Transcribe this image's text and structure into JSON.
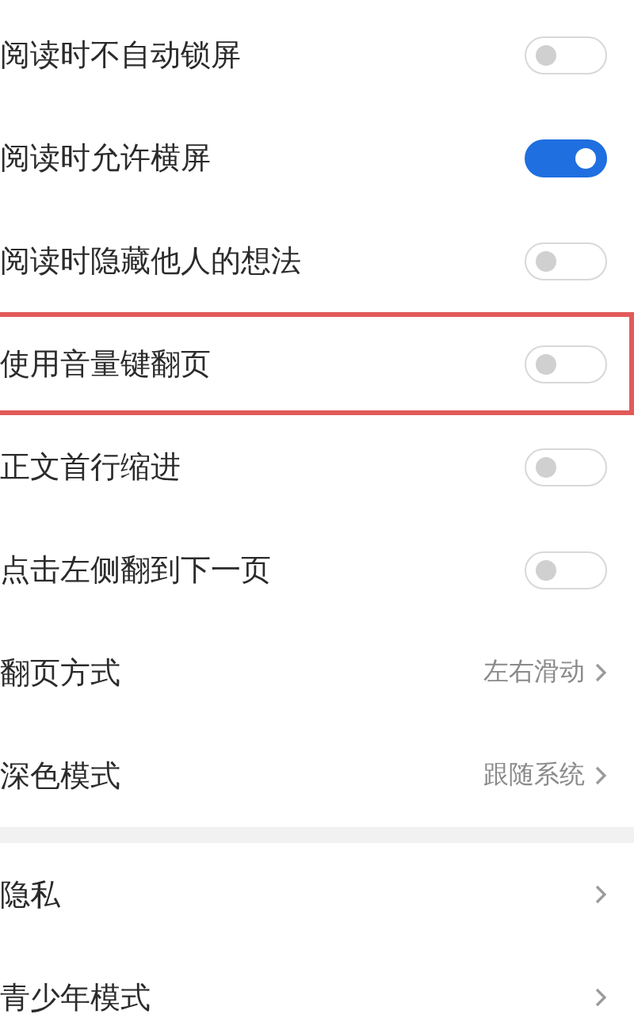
{
  "sections": [
    {
      "items": [
        {
          "kind": "toggle",
          "label": "阅读时不自动锁屏",
          "on": false,
          "highlighted": false
        },
        {
          "kind": "toggle",
          "label": "阅读时允许横屏",
          "on": true,
          "highlighted": false
        },
        {
          "kind": "toggle",
          "label": "阅读时隐藏他人的想法",
          "on": false,
          "highlighted": false
        },
        {
          "kind": "toggle",
          "label": "使用音量键翻页",
          "on": false,
          "highlighted": true
        },
        {
          "kind": "toggle",
          "label": "正文首行缩进",
          "on": false,
          "highlighted": false
        },
        {
          "kind": "toggle",
          "label": "点击左侧翻到下一页",
          "on": false,
          "highlighted": false
        },
        {
          "kind": "select",
          "label": "翻页方式",
          "value": "左右滑动",
          "highlighted": false
        },
        {
          "kind": "select",
          "label": "深色模式",
          "value": "跟随系统",
          "highlighted": false
        }
      ]
    },
    {
      "items": [
        {
          "kind": "link",
          "label": "隐私",
          "highlighted": false
        },
        {
          "kind": "link",
          "label": "青少年模式",
          "highlighted": false
        }
      ]
    }
  ]
}
